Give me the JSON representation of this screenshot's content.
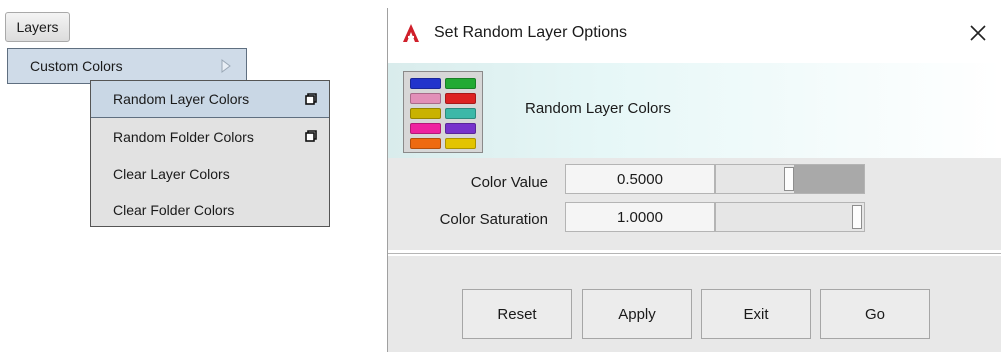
{
  "menu": {
    "root_label": "Layers",
    "level1": {
      "label": "Custom Colors"
    },
    "level2": [
      {
        "label": "Random Layer Colors",
        "has_options": true,
        "highlighted": true
      },
      {
        "label": "Random Folder Colors",
        "has_options": true,
        "highlighted": false
      },
      {
        "label": "Clear Layer Colors",
        "has_options": false,
        "highlighted": false
      },
      {
        "label": "Clear Folder Colors",
        "has_options": false,
        "highlighted": false
      }
    ]
  },
  "dialog": {
    "title": "Set Random Layer Options",
    "header_label": "Random Layer Colors",
    "swatch_colors": [
      "#2233cc",
      "#22aa33",
      "#e28fb8",
      "#dd2222",
      "#c9b200",
      "#3cb8a8",
      "#ee22a0",
      "#7733cc",
      "#ee6a10",
      "#e3c400"
    ],
    "fields": [
      {
        "label": "Color Value",
        "value": "0.5000",
        "level": 0.5
      },
      {
        "label": "Color Saturation",
        "value": "1.0000",
        "level": 1.0
      }
    ],
    "buttons": [
      "Reset",
      "Apply",
      "Exit",
      "Go"
    ]
  },
  "colors": {
    "menu_highlight": "#c9d7e5",
    "menu_bg": "#e2e2e2",
    "dialog_bg": "#e8e8e8",
    "app_icon": "#d0202b"
  }
}
